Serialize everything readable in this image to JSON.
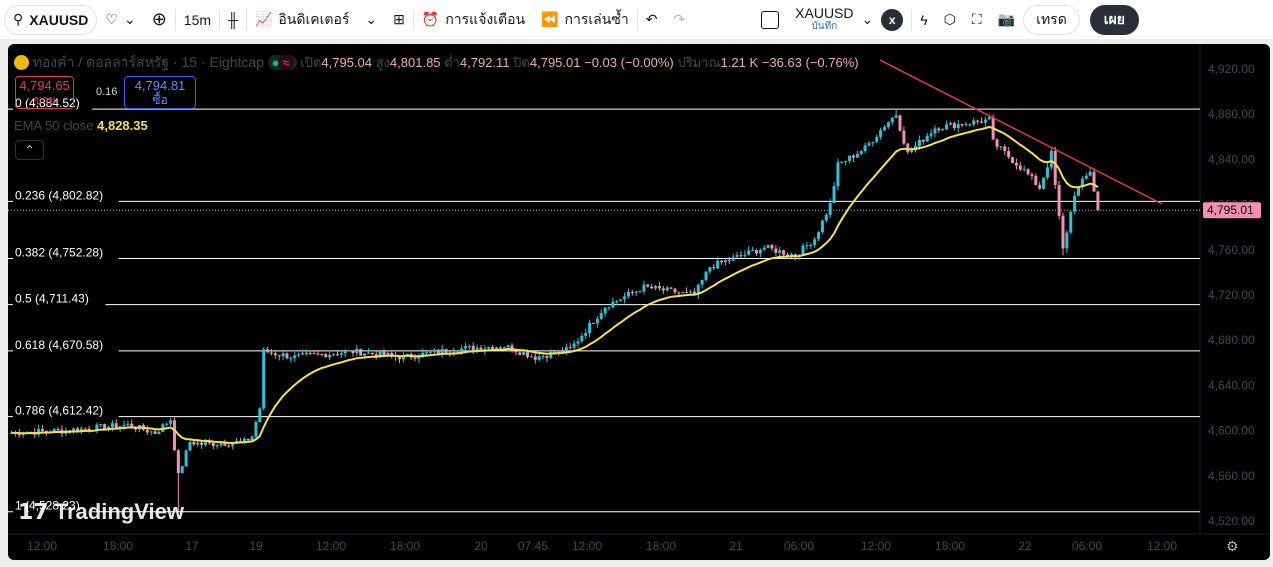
{
  "toolbar": {
    "symbol": "XAUUSD",
    "interval": "15m",
    "indicators": "อินดิเคเตอร์",
    "alerts": "การแจ้งเตือน",
    "replay": "การเล่นซ้ำ",
    "layout_name": "XAUUSD",
    "layout_status": "บันทึก",
    "layout_close": "x",
    "trade": "เทรด",
    "publish": "เผย"
  },
  "legend": {
    "title": "ทองคำ / ดอลลาร์สหรัฐ · 15 · Eightcap",
    "open_label": "เปิด",
    "open": "4,795.04",
    "high_label": "สูง",
    "high": "4,801.85",
    "low_label": "ต่ำ",
    "low": "4,792.11",
    "close_label": "ปิด",
    "close": "4,795.01",
    "change": "−0.03 (−0.00%)",
    "volume_label": "ปริมาณ",
    "volume": "1.21 K",
    "vol_change": "−36.63 (−0.76%)",
    "sell_price": "4,794.65",
    "sell_label": "ขาย",
    "spread": "0.16",
    "buy_price": "4,794.81",
    "buy_label": "ซื้อ",
    "ema_label": "EMA 50 close",
    "ema_value": "4,828.35"
  },
  "fib": [
    {
      "label": "0 (4,884.52)",
      "price": 4884.52
    },
    {
      "label": "0.236 (4,802.82)",
      "price": 4802.82
    },
    {
      "label": "0.382 (4,752.28)",
      "price": 4752.28
    },
    {
      "label": "0.5 (4,711.43)",
      "price": 4711.43
    },
    {
      "label": "0.618 (4,670.58)",
      "price": 4670.58
    },
    {
      "label": "0.786 (4,612.42)",
      "price": 4612.42
    },
    {
      "label": "1 (4,528.23)",
      "price": 4528.23
    }
  ],
  "price_axis": [
    "4,920.00",
    "4,880.00",
    "4,840.00",
    "4,800.00",
    "4,760.00",
    "4,720.00",
    "4,680.00",
    "4,640.00",
    "4,600.00",
    "4,560.00",
    "4,520.00"
  ],
  "current_price": "4,795.01",
  "current_price_value": 4795.01,
  "time_axis": [
    "12:00",
    "18:00",
    "17",
    "19",
    "12:00",
    "18:00",
    "20",
    "07:45",
    "12:00",
    "18:00",
    "21",
    "06:00",
    "12:00",
    "18:00",
    "22",
    "06:00",
    "12:00"
  ],
  "watermark": "TradingView",
  "colors": {
    "up": "#26c6da",
    "down": "#f48fb1",
    "ema": "#f5e14a",
    "trend": "#e8354e"
  },
  "price_path": [
    [
      0,
      4598
    ],
    [
      13,
      4600
    ],
    [
      30,
      4605
    ],
    [
      37,
      4598
    ],
    [
      41,
      4610
    ],
    [
      43,
      4560
    ],
    [
      46,
      4590
    ],
    [
      49,
      4588
    ],
    [
      60,
      4590
    ],
    [
      62,
      4595
    ],
    [
      64,
      4620
    ],
    [
      65,
      4670
    ],
    [
      73,
      4665
    ],
    [
      88,
      4670
    ],
    [
      101,
      4665
    ],
    [
      114,
      4672
    ],
    [
      127,
      4675
    ],
    [
      135,
      4665
    ],
    [
      144,
      4672
    ],
    [
      153,
      4710
    ],
    [
      163,
      4727
    ],
    [
      176,
      4720
    ],
    [
      180,
      4745
    ],
    [
      194,
      4762
    ],
    [
      202,
      4755
    ],
    [
      207,
      4770
    ],
    [
      211,
      4800
    ],
    [
      213,
      4835
    ],
    [
      220,
      4850
    ],
    [
      225,
      4870
    ],
    [
      228,
      4880
    ],
    [
      231,
      4845
    ],
    [
      238,
      4868
    ],
    [
      252,
      4875
    ],
    [
      253,
      4855
    ],
    [
      261,
      4830
    ],
    [
      265,
      4815
    ],
    [
      268,
      4845
    ],
    [
      271,
      4760
    ],
    [
      274,
      4810
    ],
    [
      278,
      4830
    ],
    [
      280,
      4795
    ]
  ]
}
